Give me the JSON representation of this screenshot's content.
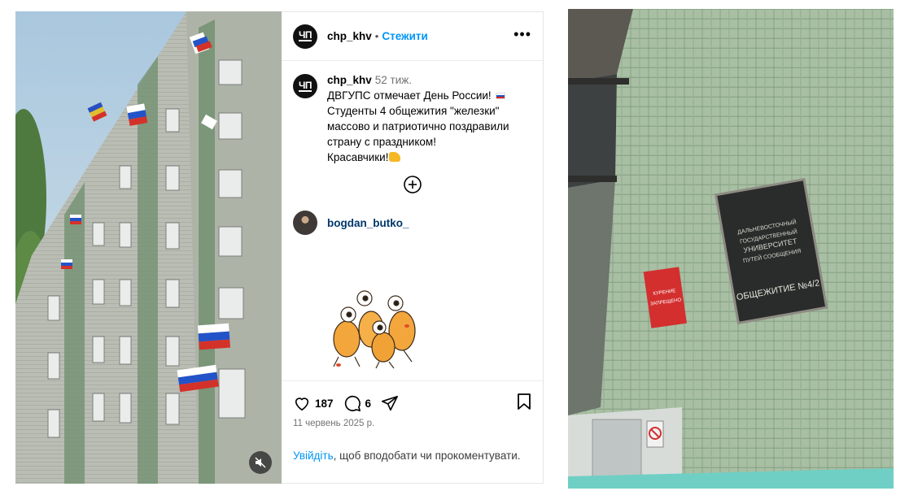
{
  "post": {
    "username": "chp_khv",
    "follow_label": "Стежити",
    "more_label": "•••",
    "avatar_text": "ЧП",
    "caption_time": "52 тиж.",
    "caption_lines": [
      "ДВГУПС отмечает День России! ",
      "",
      "Студенты 4 общежития \"железки\"",
      "массово и патриотично поздравили",
      "страну с праздником!",
      "",
      "Красавчики!"
    ],
    "flag_emoji": "russia-flag",
    "muscle_emoji": "flexed-biceps"
  },
  "comment": {
    "username": "bogdan_butko_"
  },
  "actions": {
    "likes": "187",
    "comments": "6",
    "date": "11 червень 2025 р."
  },
  "login_prompt": {
    "link": "Увійдіть",
    "text": ", щоб вподобати чи прокоментувати."
  },
  "icons": {
    "like": "heart-icon",
    "comment": "comment-icon",
    "share": "share-icon",
    "save": "bookmark-icon",
    "add": "plus-circle-icon",
    "mute": "speaker-muted-icon"
  },
  "photo2": {
    "sign_red_lines": [
      "КУРЕНИЕ",
      "ЗАПРЕЩЕНО"
    ],
    "plaque_lines": [
      "ДАЛЬНЕВОСТОЧНЫЙ",
      "ГОСУДАРСТВЕННЫЙ",
      "УНИВЕРСИТЕТ",
      "ПУТЕЙ СООБЩЕНИЯ",
      "ОБЩЕЖИТИЕ №4/2"
    ]
  },
  "colors": {
    "accent": "#0095f6",
    "link_dark": "#00376b",
    "muted": "#737373"
  }
}
